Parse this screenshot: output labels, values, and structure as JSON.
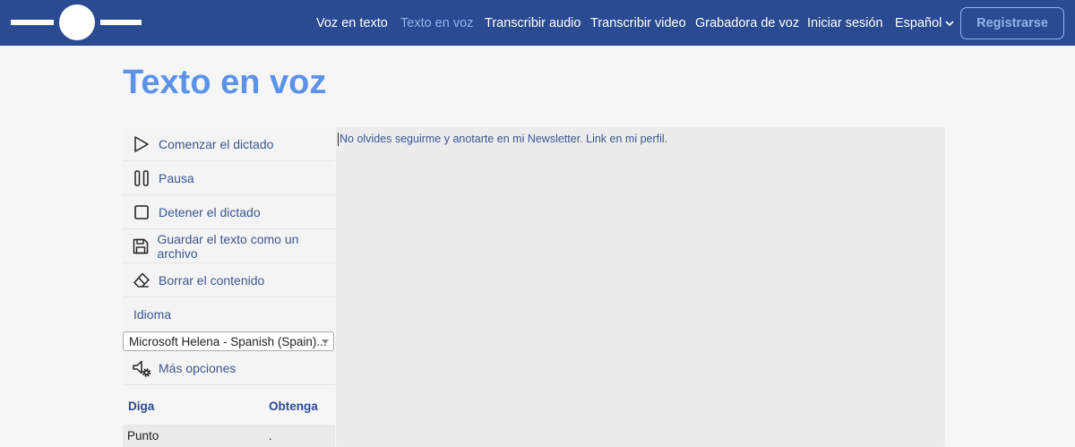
{
  "header": {
    "nav": [
      {
        "label": "Voz en texto",
        "active": false
      },
      {
        "label": "Texto en voz",
        "active": true
      },
      {
        "label": "Transcribir audio",
        "active": false
      },
      {
        "label": "Transcribir video",
        "active": false
      },
      {
        "label": "Grabadora de voz",
        "active": false
      },
      {
        "label": "Iniciar sesión",
        "active": false
      }
    ],
    "language": "Español",
    "register_label": "Registrarse"
  },
  "page": {
    "title": "Texto en voz"
  },
  "menu": {
    "items": [
      {
        "label": "Comenzar el dictado",
        "icon": "play-icon"
      },
      {
        "label": "Pausa",
        "icon": "pause-icon"
      },
      {
        "label": "Detener el dictado",
        "icon": "stop-icon"
      },
      {
        "label": "Guardar el texto como un archivo",
        "icon": "save-icon"
      },
      {
        "label": "Borrar el contenido",
        "icon": "eraser-icon"
      }
    ],
    "language_label": "Idioma",
    "voice_selected": "Microsoft Helena - Spanish (Spain)...",
    "more_options": "Más opciones"
  },
  "commands": {
    "headers": [
      "Diga",
      "Obtenga"
    ],
    "rows": [
      [
        "Punto",
        "."
      ]
    ]
  },
  "editor": {
    "text": "No olvides seguirme y anotarte en mi Newsletter. Link en mi perfil."
  },
  "colors": {
    "header_bg": "#2a4a91",
    "accent": "#5b93e8",
    "active_link": "#8fb3ee"
  }
}
